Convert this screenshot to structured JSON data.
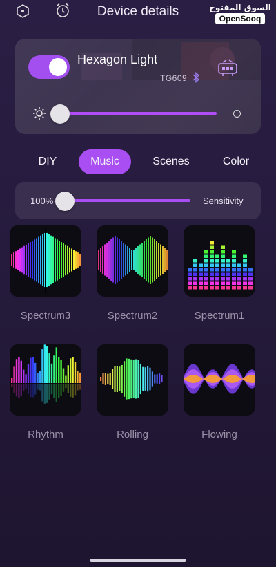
{
  "header": {
    "title": "Device details",
    "left_icons": [
      "hexagon-settings-icon",
      "alarm-clock-icon"
    ]
  },
  "watermark": {
    "arabic": "السوق المفتوح",
    "english": "OpenSooq"
  },
  "device": {
    "name": "Hexagon Light",
    "model": "TG609",
    "power_on": true,
    "brightness_fraction": 0.0,
    "icons": [
      "bluetooth-icon",
      "device-icon",
      "sun-icon",
      "moon-icon"
    ]
  },
  "tabs": [
    {
      "label": "DIY",
      "active": false
    },
    {
      "label": "Music",
      "active": true
    },
    {
      "label": "Scenes",
      "active": false
    },
    {
      "label": "Color",
      "active": false
    }
  ],
  "sensitivity": {
    "value": "100%",
    "label": "Sensitivity",
    "fraction": 0.0
  },
  "effects": [
    {
      "label": "Spectrum3",
      "style": "mirror"
    },
    {
      "label": "Spectrum2",
      "style": "double"
    },
    {
      "label": "Spectrum1",
      "style": "blocks"
    },
    {
      "label": "Rhythm",
      "style": "rhythm"
    },
    {
      "label": "Rolling",
      "style": "rolling"
    },
    {
      "label": "Flowing",
      "style": "flowing"
    }
  ],
  "colors": {
    "accent": "#a84ef2",
    "background": "#271c3f",
    "card": "#3a2f4e"
  }
}
